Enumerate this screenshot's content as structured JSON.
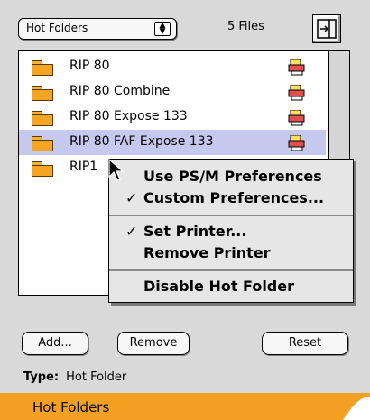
{
  "header": {
    "popup_value": "Hot Folders",
    "file_count": "5 Files"
  },
  "list": {
    "items": [
      {
        "label": "RIP 80"
      },
      {
        "label": "RIP 80 Combine"
      },
      {
        "label": "RIP 80 Expose 133"
      },
      {
        "label": "RIP 80 FAF Expose 133",
        "selected": true
      },
      {
        "label": "RIP1"
      }
    ]
  },
  "context_menu": {
    "items": [
      {
        "label": "Use PS/M Preferences",
        "checked": false
      },
      {
        "label": "Custom Preferences...",
        "checked": true
      },
      {
        "label": "Set Printer...",
        "checked": true
      },
      {
        "label": "Remove Printer",
        "checked": false
      },
      {
        "label": "Disable Hot Folder",
        "checked": false
      }
    ],
    "check_mark": "✓"
  },
  "buttons": {
    "add": "Add...",
    "remove": "Remove",
    "reset": "Reset"
  },
  "type_line": {
    "label": "Type:",
    "value": "Hot Folder"
  },
  "footer": {
    "label": "Hot Folders"
  },
  "colors": {
    "panel": "#d9d9d9",
    "selection": "#c6c9ee",
    "footer_orange": "#f4a023",
    "folder_orange": "#f6a523"
  }
}
